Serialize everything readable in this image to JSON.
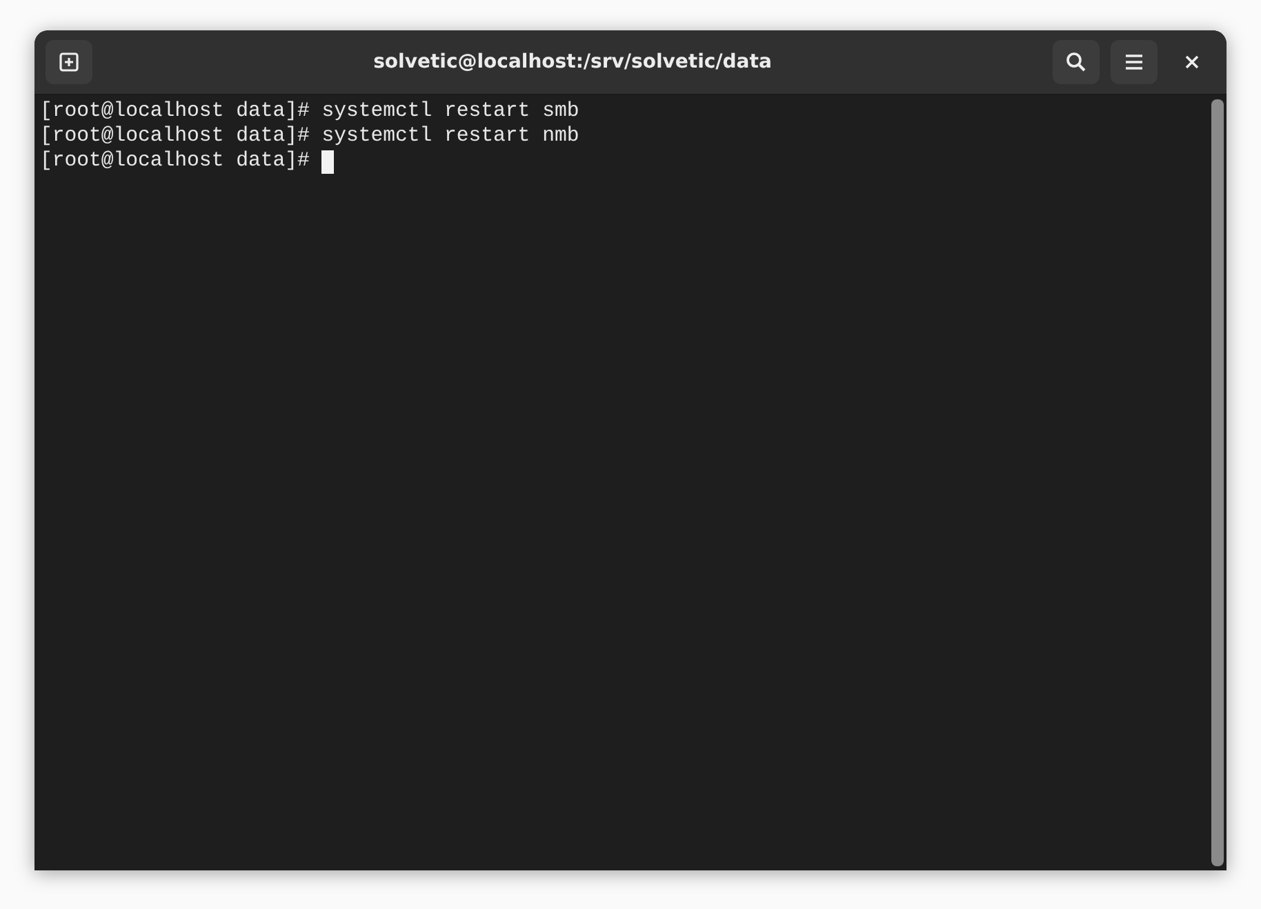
{
  "window": {
    "title": "solvetic@localhost:/srv/solvetic/data"
  },
  "terminal": {
    "lines": [
      {
        "prompt": "[root@localhost data]#",
        "command": "systemctl restart smb",
        "cursor": false
      },
      {
        "prompt": "[root@localhost data]#",
        "command": "systemctl restart nmb",
        "cursor": false
      },
      {
        "prompt": "[root@localhost data]#",
        "cursor": true
      }
    ]
  }
}
